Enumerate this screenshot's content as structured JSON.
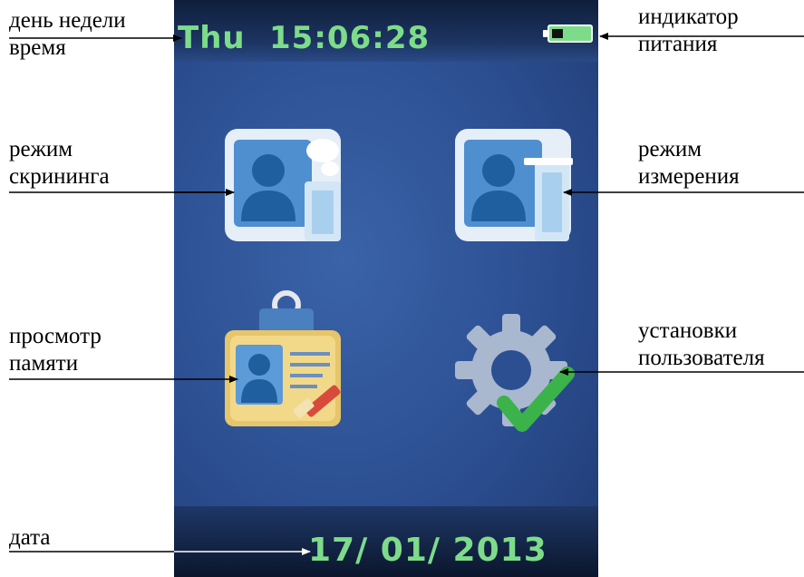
{
  "device": {
    "weekday": "Thu",
    "time": "15:06:28",
    "date": "17/ 01/ 2013",
    "lcd_color": "#7ddc8a",
    "battery_level": 0.75
  },
  "icons": [
    {
      "name": "screening-mode-icon"
    },
    {
      "name": "measurement-mode-icon"
    },
    {
      "name": "memory-view-icon"
    },
    {
      "name": "user-settings-icon"
    }
  ],
  "callouts": {
    "weekday_time": {
      "line1": "день недели",
      "line2": "время"
    },
    "battery": {
      "line1": "индикатор",
      "line2": "питания"
    },
    "screening": {
      "line1": "режим",
      "line2": "скрининга"
    },
    "measurement": {
      "line1": "режим",
      "line2": "измерения"
    },
    "memory": {
      "line1": "просмотр",
      "line2": "памяти"
    },
    "settings": {
      "line1": "установки",
      "line2": "пользователя"
    },
    "date": {
      "line1": "дата"
    }
  }
}
